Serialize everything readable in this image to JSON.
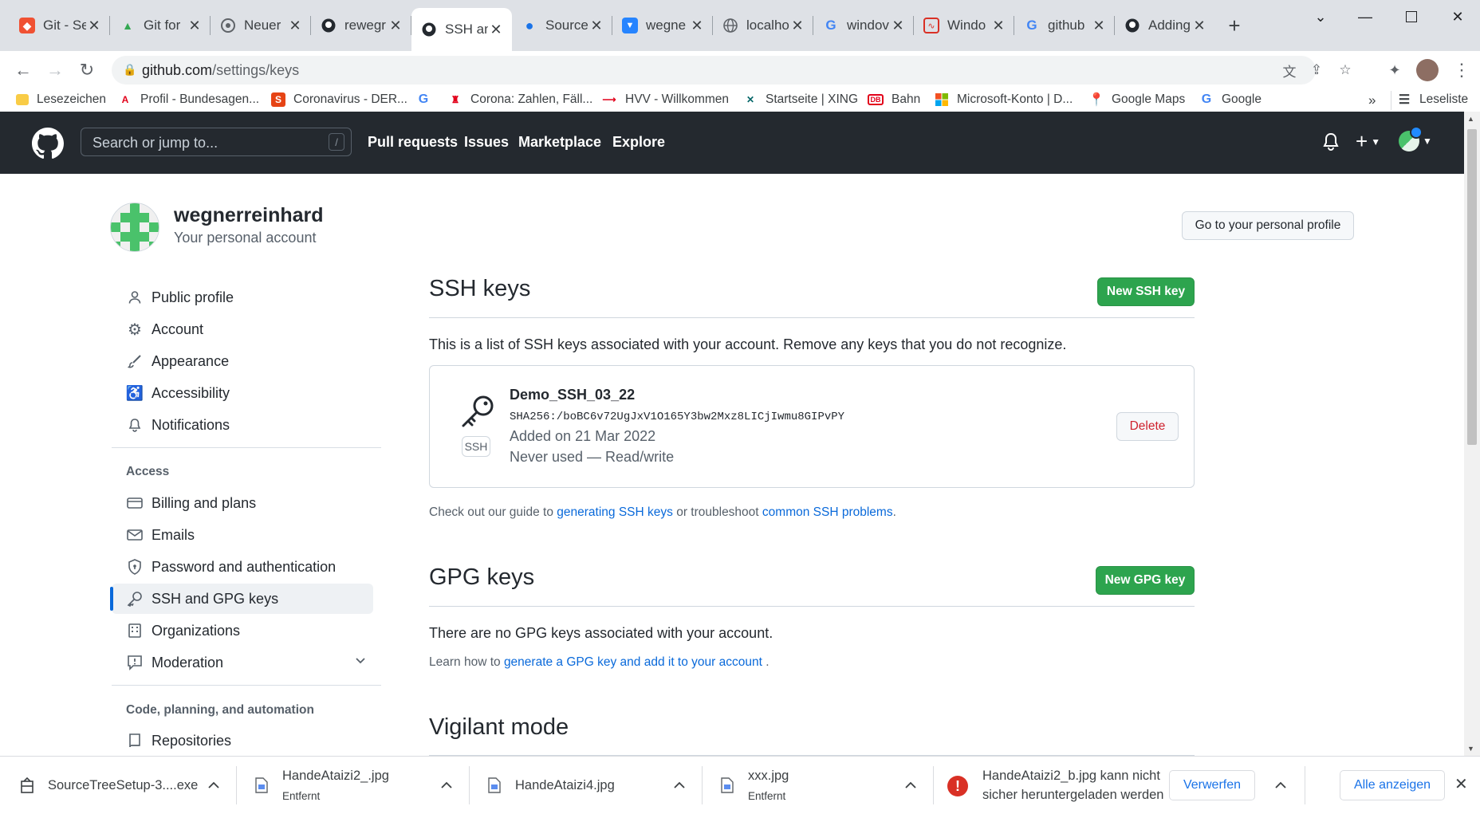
{
  "tabs": [
    {
      "title": "Git - Se",
      "icon": "git-icon",
      "color": "#f05133"
    },
    {
      "title": "Git for",
      "icon": "google-drive-icon",
      "color": "#34a853"
    },
    {
      "title": "Neuer",
      "icon": "chrome-icon",
      "color": "#5f6368"
    },
    {
      "title": "rewegr",
      "icon": "github-icon",
      "color": "#24292f"
    },
    {
      "title": "SSH an",
      "icon": "github-icon",
      "color": "#24292f"
    },
    {
      "title": "Source",
      "icon": "map-pin-icon",
      "color": "#1a73e8"
    },
    {
      "title": "wegne",
      "icon": "bitbucket-icon",
      "color": "#2684ff"
    },
    {
      "title": "localho",
      "icon": "globe-icon",
      "color": "#5f6368"
    },
    {
      "title": "windov",
      "icon": "google-icon",
      "color": "#4285f4"
    },
    {
      "title": "Windo",
      "icon": "pdf-icon",
      "color": "#d93025"
    },
    {
      "title": "github",
      "icon": "google-icon",
      "color": "#4285f4"
    },
    {
      "title": "Adding",
      "icon": "github-icon",
      "color": "#24292f"
    }
  ],
  "address": {
    "domain": "github.com",
    "path": "/settings/keys"
  },
  "bookmarks": [
    {
      "label": "Lesezeichen",
      "icon": "folder-icon"
    },
    {
      "label": "Profil - Bundesagen...",
      "icon": "arbeitsagentur-icon"
    },
    {
      "label": "Coronavirus - DER...",
      "icon": "spiegel-icon"
    },
    {
      "label": "",
      "icon": "google-icon"
    },
    {
      "label": "Corona: Zahlen, Fäll...",
      "icon": "hamburg-icon"
    },
    {
      "label": "HVV - Willkommen",
      "icon": "hvv-icon"
    },
    {
      "label": "Startseite | XING",
      "icon": "xing-icon"
    },
    {
      "label": "Bahn",
      "icon": "db-icon"
    },
    {
      "label": "Microsoft-Konto | D...",
      "icon": "microsoft-icon"
    },
    {
      "label": "Google Maps",
      "icon": "google-maps-icon"
    },
    {
      "label": "Google",
      "icon": "google-icon"
    }
  ],
  "bookmarks_more": "»",
  "reading_list": "Leseliste",
  "github": {
    "search_placeholder": "Search or jump to...",
    "search_shortcut": "/",
    "nav": [
      "Pull requests",
      "Issues",
      "Marketplace",
      "Explore"
    ]
  },
  "account": {
    "username": "wegnerreinhard",
    "subtitle": "Your personal account",
    "profile_button": "Go to your personal profile"
  },
  "sidebar": {
    "items": [
      {
        "label": "Public profile",
        "icon": "person-icon"
      },
      {
        "label": "Account",
        "icon": "gear-icon"
      },
      {
        "label": "Appearance",
        "icon": "paintbrush-icon"
      },
      {
        "label": "Accessibility",
        "icon": "accessibility-icon"
      },
      {
        "label": "Notifications",
        "icon": "bell-icon"
      }
    ],
    "access_heading": "Access",
    "access_items": [
      {
        "label": "Billing and plans",
        "icon": "credit-card-icon"
      },
      {
        "label": "Emails",
        "icon": "mail-icon"
      },
      {
        "label": "Password and authentication",
        "icon": "shield-lock-icon"
      },
      {
        "label": "SSH and GPG keys",
        "icon": "key-icon",
        "selected": true
      },
      {
        "label": "Organizations",
        "icon": "organization-icon"
      },
      {
        "label": "Moderation",
        "icon": "report-icon"
      }
    ],
    "code_heading": "Code, planning, and automation",
    "code_items": [
      {
        "label": "Repositories",
        "icon": "repo-icon"
      }
    ]
  },
  "ssh": {
    "title": "SSH keys",
    "new_button": "New SSH key",
    "description": "This is a list of SSH keys associated with your account. Remove any keys that you do not recognize.",
    "key": {
      "name": "Demo_SSH_03_22",
      "fingerprint": "SHA256:/boBC6v72UgJxV1O165Y3bw2Mxz8LICjIwmu8GIPvPY",
      "added": "Added on 21 Mar 2022",
      "usage": "Never used — Read/write",
      "badge": "SSH",
      "delete_button": "Delete"
    },
    "guide_prefix": "Check out our guide to",
    "guide_link1": "generating SSH keys",
    "guide_middle": "or troubleshoot",
    "guide_link2": "common SSH problems",
    "guide_suffix": "."
  },
  "gpg": {
    "title": "GPG keys",
    "new_button": "New GPG key",
    "empty": "There are no GPG keys associated with your account.",
    "learn_prefix": "Learn how to",
    "learn_link": "generate a GPG key and add it to your account",
    "learn_suffix": "."
  },
  "vigilant": {
    "title": "Vigilant mode"
  },
  "downloads": [
    {
      "name": "SourceTreeSetup-3....exe",
      "sub": ""
    },
    {
      "name": "HandeAtaizi2_.jpg",
      "sub": "Entfernt"
    },
    {
      "name": "HandeAtaizi4.jpg",
      "sub": ""
    },
    {
      "name": "xxx.jpg",
      "sub": "Entfernt"
    }
  ],
  "download_warning": {
    "line1": "HandeAtaizi2_b.jpg kann nicht",
    "line2": "sicher heruntergeladen werden",
    "discard_button": "Verwerfen"
  },
  "show_all_button": "Alle anzeigen",
  "colors": {
    "github_header": "#24292f",
    "accent_green": "#2da44e",
    "link_blue": "#0969da",
    "danger": "#cf222e"
  }
}
